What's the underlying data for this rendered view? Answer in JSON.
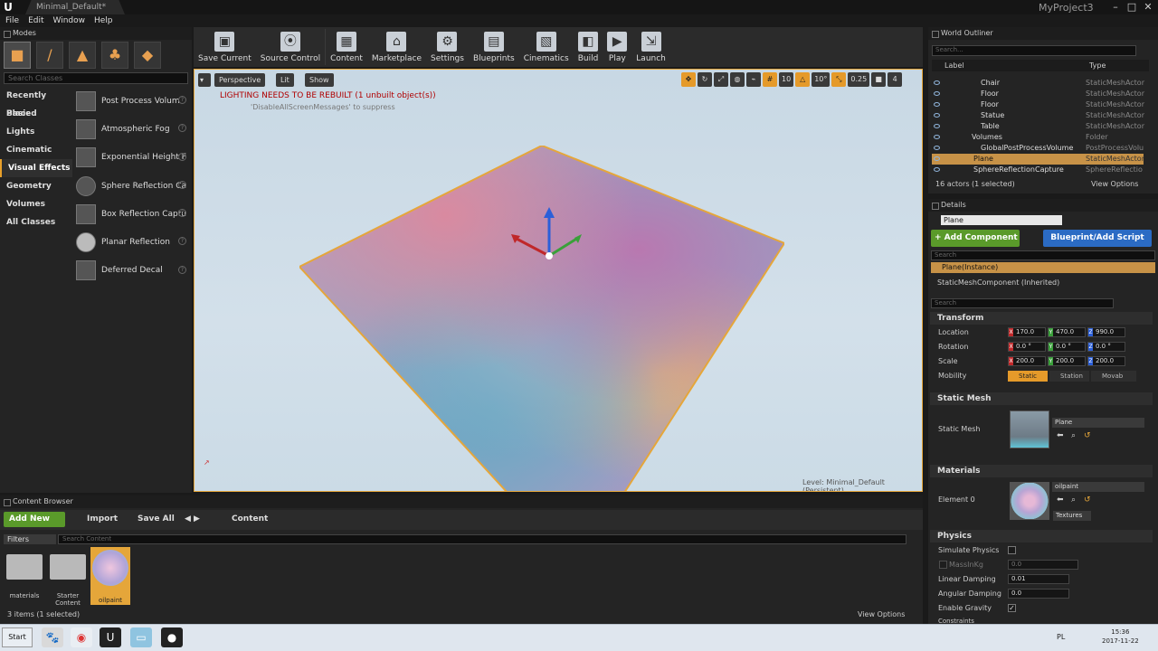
{
  "title_bar": {
    "doc_tab": "Minimal_Default*",
    "project": "MyProject3"
  },
  "menu": [
    "File",
    "Edit",
    "Window",
    "Help"
  ],
  "modes": {
    "title": "Modes",
    "search_placeholder": "Search Classes",
    "categories": [
      "Recently Placed",
      "Basic",
      "Lights",
      "Cinematic",
      "Visual Effects",
      "Geometry",
      "Volumes",
      "All Classes"
    ],
    "active_category": "Visual Effects",
    "items": [
      "Post Process Volum",
      "Atmospheric Fog",
      "Exponential Height F",
      "Sphere Reflection Ca",
      "Box Reflection Captu",
      "Planar Reflection",
      "Deferred Decal"
    ]
  },
  "toolbar": [
    {
      "label": "Save Current",
      "icon": "save-icon"
    },
    {
      "label": "Source Control",
      "icon": "source-control-icon"
    },
    {
      "label": "Content",
      "icon": "content-icon"
    },
    {
      "label": "Marketplace",
      "icon": "marketplace-icon"
    },
    {
      "label": "Settings",
      "icon": "settings-icon"
    },
    {
      "label": "Blueprints",
      "icon": "blueprints-icon"
    },
    {
      "label": "Cinematics",
      "icon": "cinematics-icon"
    },
    {
      "label": "Build",
      "icon": "build-icon"
    },
    {
      "label": "Play",
      "icon": "play-icon"
    },
    {
      "label": "Launch",
      "icon": "launch-icon"
    }
  ],
  "viewport": {
    "perspective": "Perspective",
    "lit": "Lit",
    "show": "Show",
    "warning": "LIGHTING NEEDS TO BE REBUILT (1 unbuilt object(s))",
    "suppress": "'DisableAllScreenMessages' to suppress",
    "level": "Level:  Minimal_Default (Persistent)",
    "grid_snap": "10",
    "rot_snap": "10°",
    "scale_snap": "0.25",
    "cam_speed": "4"
  },
  "outliner": {
    "title": "World Outliner",
    "search_placeholder": "Search...",
    "col_label": "Label",
    "col_type": "Type",
    "rows": [
      {
        "label": "Chair",
        "type": "StaticMeshActor"
      },
      {
        "label": "Floor",
        "type": "StaticMeshActor"
      },
      {
        "label": "Floor",
        "type": "StaticMeshActor"
      },
      {
        "label": "Statue",
        "type": "StaticMeshActor"
      },
      {
        "label": "Table",
        "type": "StaticMeshActor"
      },
      {
        "label": "Volumes",
        "type": "Folder"
      },
      {
        "label": "GlobalPostProcessVolume",
        "type": "PostProcessVolu"
      },
      {
        "label": "Plane",
        "type": "StaticMeshActor"
      },
      {
        "label": "SphereReflectionCapture",
        "type": "SphereReflectio"
      }
    ],
    "count": "16 actors (1 selected)",
    "view_options": "View Options"
  },
  "details": {
    "title": "Details",
    "name": "Plane",
    "add_component": "+ Add Component",
    "blueprint": "Blueprint/Add Script",
    "search_placeholder": "Search",
    "instance": "Plane(Instance)",
    "component": "StaticMeshComponent (Inherited)",
    "transform": "Transform",
    "location_label": "Location",
    "rotation_label": "Rotation",
    "scale_label": "Scale",
    "mobility_label": "Mobility",
    "location": [
      "170.0",
      "470.0",
      "990.0"
    ],
    "rotation": [
      "0.0 °",
      "0.0 °",
      "0.0 °"
    ],
    "scale": [
      "200.0",
      "200.0",
      "200.0"
    ],
    "mobility": [
      "Static",
      "Station",
      "Movab"
    ],
    "static_mesh_section": "Static Mesh",
    "static_mesh_label": "Static Mesh",
    "mesh_value": "Plane",
    "materials_section": "Materials",
    "element0_label": "Element 0",
    "material_value": "oilpaint",
    "textures": "Textures",
    "physics_section": "Physics",
    "simulate_physics": "Simulate Physics",
    "mass_label": "MassInKg",
    "mass_value": "0.0",
    "linear_damping_label": "Linear Damping",
    "linear_damping": "0.01",
    "angular_damping_label": "Angular Damping",
    "angular_damping": "0.0",
    "enable_gravity": "Enable Gravity",
    "constraints": "Constraints"
  },
  "content_browser": {
    "title": "Content Browser",
    "add_new": "Add New",
    "import": "Import",
    "save_all": "Save All",
    "path": "Content",
    "filters": "Filters",
    "search_placeholder": "Search Content",
    "assets": [
      {
        "label": "materials"
      },
      {
        "label": "Starter Content"
      },
      {
        "label": "oilpaint"
      }
    ],
    "count": "3 items (1 selected)",
    "view_options": "View Options"
  },
  "taskbar": {
    "start": "Start",
    "lang": "PL",
    "time": "15:36",
    "date": "2017-11-22"
  }
}
